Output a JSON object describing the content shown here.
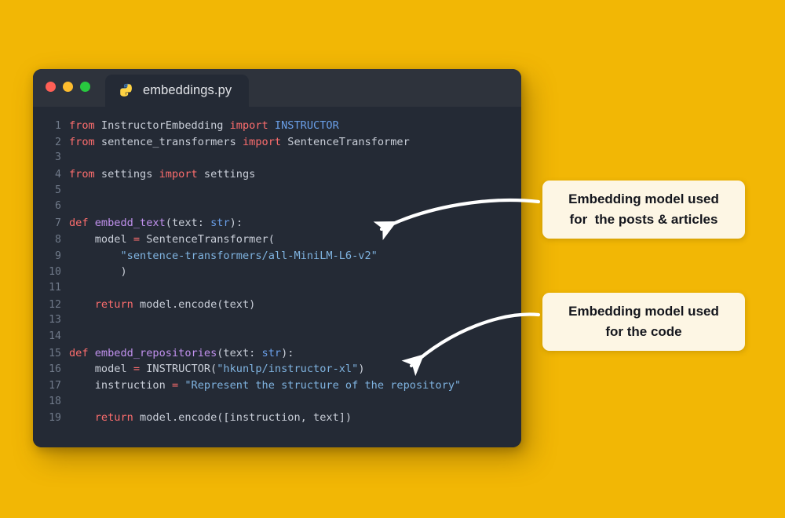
{
  "background_color": "#F2B705",
  "window": {
    "title_bar_color": "#2E333C",
    "body_color": "#242A35",
    "traffic_lights": [
      {
        "name": "close",
        "color": "#FF5F56"
      },
      {
        "name": "minimize",
        "color": "#FDBC2E"
      },
      {
        "name": "maximize",
        "color": "#28C93F"
      }
    ],
    "tab": {
      "label": "embeddings.py",
      "icon": "python-icon"
    }
  },
  "code": {
    "language": "python",
    "lines": [
      {
        "num": "1",
        "tokens": [
          {
            "t": "from",
            "c": "kw"
          },
          {
            "t": " InstructorEmbedding ",
            "c": "pl"
          },
          {
            "t": "import",
            "c": "kw"
          },
          {
            "t": " ",
            "c": "pl"
          },
          {
            "t": "INSTRUCTOR",
            "c": "cls"
          }
        ]
      },
      {
        "num": "2",
        "tokens": [
          {
            "t": "from",
            "c": "kw"
          },
          {
            "t": " sentence_transformers ",
            "c": "pl"
          },
          {
            "t": "import",
            "c": "kw"
          },
          {
            "t": " SentenceTransformer",
            "c": "pl"
          }
        ]
      },
      {
        "num": "3",
        "tokens": []
      },
      {
        "num": "4",
        "tokens": [
          {
            "t": "from",
            "c": "kw"
          },
          {
            "t": " settings ",
            "c": "pl"
          },
          {
            "t": "import",
            "c": "kw"
          },
          {
            "t": " settings",
            "c": "pl"
          }
        ]
      },
      {
        "num": "5",
        "tokens": []
      },
      {
        "num": "6",
        "tokens": []
      },
      {
        "num": "7",
        "tokens": [
          {
            "t": "def",
            "c": "kw"
          },
          {
            "t": " ",
            "c": "pl"
          },
          {
            "t": "embedd_text",
            "c": "def"
          },
          {
            "t": "(text: ",
            "c": "pl"
          },
          {
            "t": "str",
            "c": "cls"
          },
          {
            "t": "):",
            "c": "pl"
          }
        ]
      },
      {
        "num": "8",
        "tokens": [
          {
            "t": "    model ",
            "c": "pl"
          },
          {
            "t": "=",
            "c": "op"
          },
          {
            "t": " SentenceTransformer(",
            "c": "pl"
          }
        ]
      },
      {
        "num": "9",
        "tokens": [
          {
            "t": "        ",
            "c": "pl"
          },
          {
            "t": "\"sentence-transformers/all-MiniLM-L6-v2\"",
            "c": "str"
          }
        ]
      },
      {
        "num": "10",
        "tokens": [
          {
            "t": "        )",
            "c": "pl"
          }
        ]
      },
      {
        "num": "11",
        "tokens": []
      },
      {
        "num": "12",
        "tokens": [
          {
            "t": "    ",
            "c": "pl"
          },
          {
            "t": "return",
            "c": "kw"
          },
          {
            "t": " model.encode(text)",
            "c": "pl"
          }
        ]
      },
      {
        "num": "13",
        "tokens": []
      },
      {
        "num": "14",
        "tokens": []
      },
      {
        "num": "15",
        "tokens": [
          {
            "t": "def",
            "c": "kw"
          },
          {
            "t": " ",
            "c": "pl"
          },
          {
            "t": "embedd_repositories",
            "c": "def"
          },
          {
            "t": "(text: ",
            "c": "pl"
          },
          {
            "t": "str",
            "c": "cls"
          },
          {
            "t": "):",
            "c": "pl"
          }
        ]
      },
      {
        "num": "16",
        "tokens": [
          {
            "t": "    model ",
            "c": "pl"
          },
          {
            "t": "=",
            "c": "op"
          },
          {
            "t": " INSTRUCTOR(",
            "c": "pl"
          },
          {
            "t": "\"hkunlp/instructor-xl\"",
            "c": "str"
          },
          {
            "t": ")",
            "c": "pl"
          }
        ]
      },
      {
        "num": "17",
        "tokens": [
          {
            "t": "    instruction ",
            "c": "pl"
          },
          {
            "t": "=",
            "c": "op"
          },
          {
            "t": " ",
            "c": "pl"
          },
          {
            "t": "\"Represent the structure of the repository\"",
            "c": "str"
          }
        ]
      },
      {
        "num": "18",
        "tokens": []
      },
      {
        "num": "19",
        "tokens": [
          {
            "t": "    ",
            "c": "pl"
          },
          {
            "t": "return",
            "c": "kw"
          },
          {
            "t": " model.encode([instruction, text])",
            "c": "pl"
          }
        ]
      }
    ]
  },
  "annotations": [
    {
      "id": "callout-posts",
      "line1": "Embedding model used",
      "line2": "for  the posts & articles",
      "background": "#FDF6E4",
      "text_color": "#14161D"
    },
    {
      "id": "callout-code",
      "line1": "Embedding model used",
      "line2": "for the code",
      "background": "#FDF6E4",
      "text_color": "#14161D"
    }
  ],
  "arrows": [
    {
      "name": "arrow-to-line-8",
      "color": "#FFFFFF"
    },
    {
      "name": "arrow-to-line-16",
      "color": "#FFFFFF"
    }
  ]
}
